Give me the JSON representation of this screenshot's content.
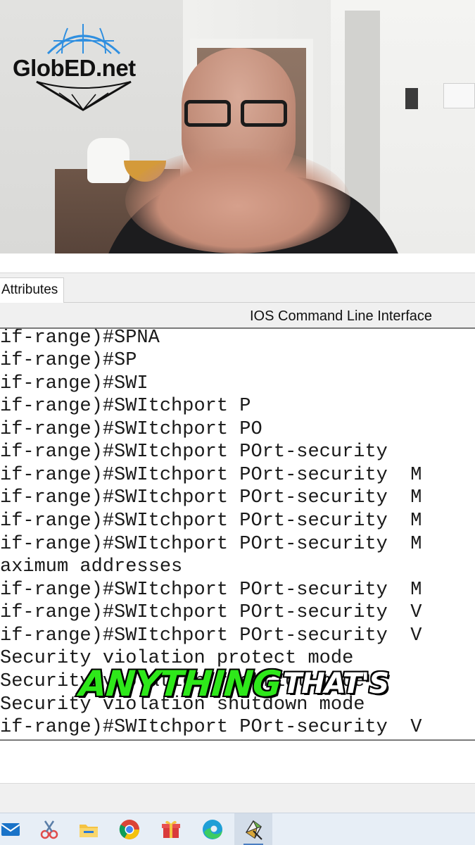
{
  "logo": {
    "text": "GlobED.net"
  },
  "tabs": {
    "attributes_label": "Attributes"
  },
  "cli": {
    "title": "IOS Command Line Interface",
    "lines": [
      "if-range)#SPNA",
      "if-range)#SP",
      "if-range)#SWI",
      "if-range)#SWItchport P",
      "if-range)#SWItchport PO",
      "if-range)#SWItchport POrt-security",
      "if-range)#SWItchport POrt-security  M",
      "if-range)#SWItchport POrt-security  M",
      "if-range)#SWItchport POrt-security  M",
      "if-range)#SWItchport POrt-security  M",
      "aximum addresses",
      "if-range)#SWItchport POrt-security  M",
      "if-range)#SWItchport POrt-security  V",
      "if-range)#SWItchport POrt-security  V",
      "Security violation protect mode",
      "Security violation restrict mode",
      "Security violation shutdown mode",
      "if-range)#SWItchport POrt-security  V"
    ]
  },
  "caption": {
    "word1": "ANYTHING",
    "word2": "THAT'S",
    "word1_color": "#2ee81a",
    "word2_color": "#ffffff"
  },
  "taskbar": {
    "icons": [
      "mail-icon",
      "snipping-tool-icon",
      "file-explorer-icon",
      "chrome-icon",
      "gift-icon",
      "edge-icon",
      "packet-tracer-icon"
    ],
    "active": "packet-tracer-icon"
  }
}
